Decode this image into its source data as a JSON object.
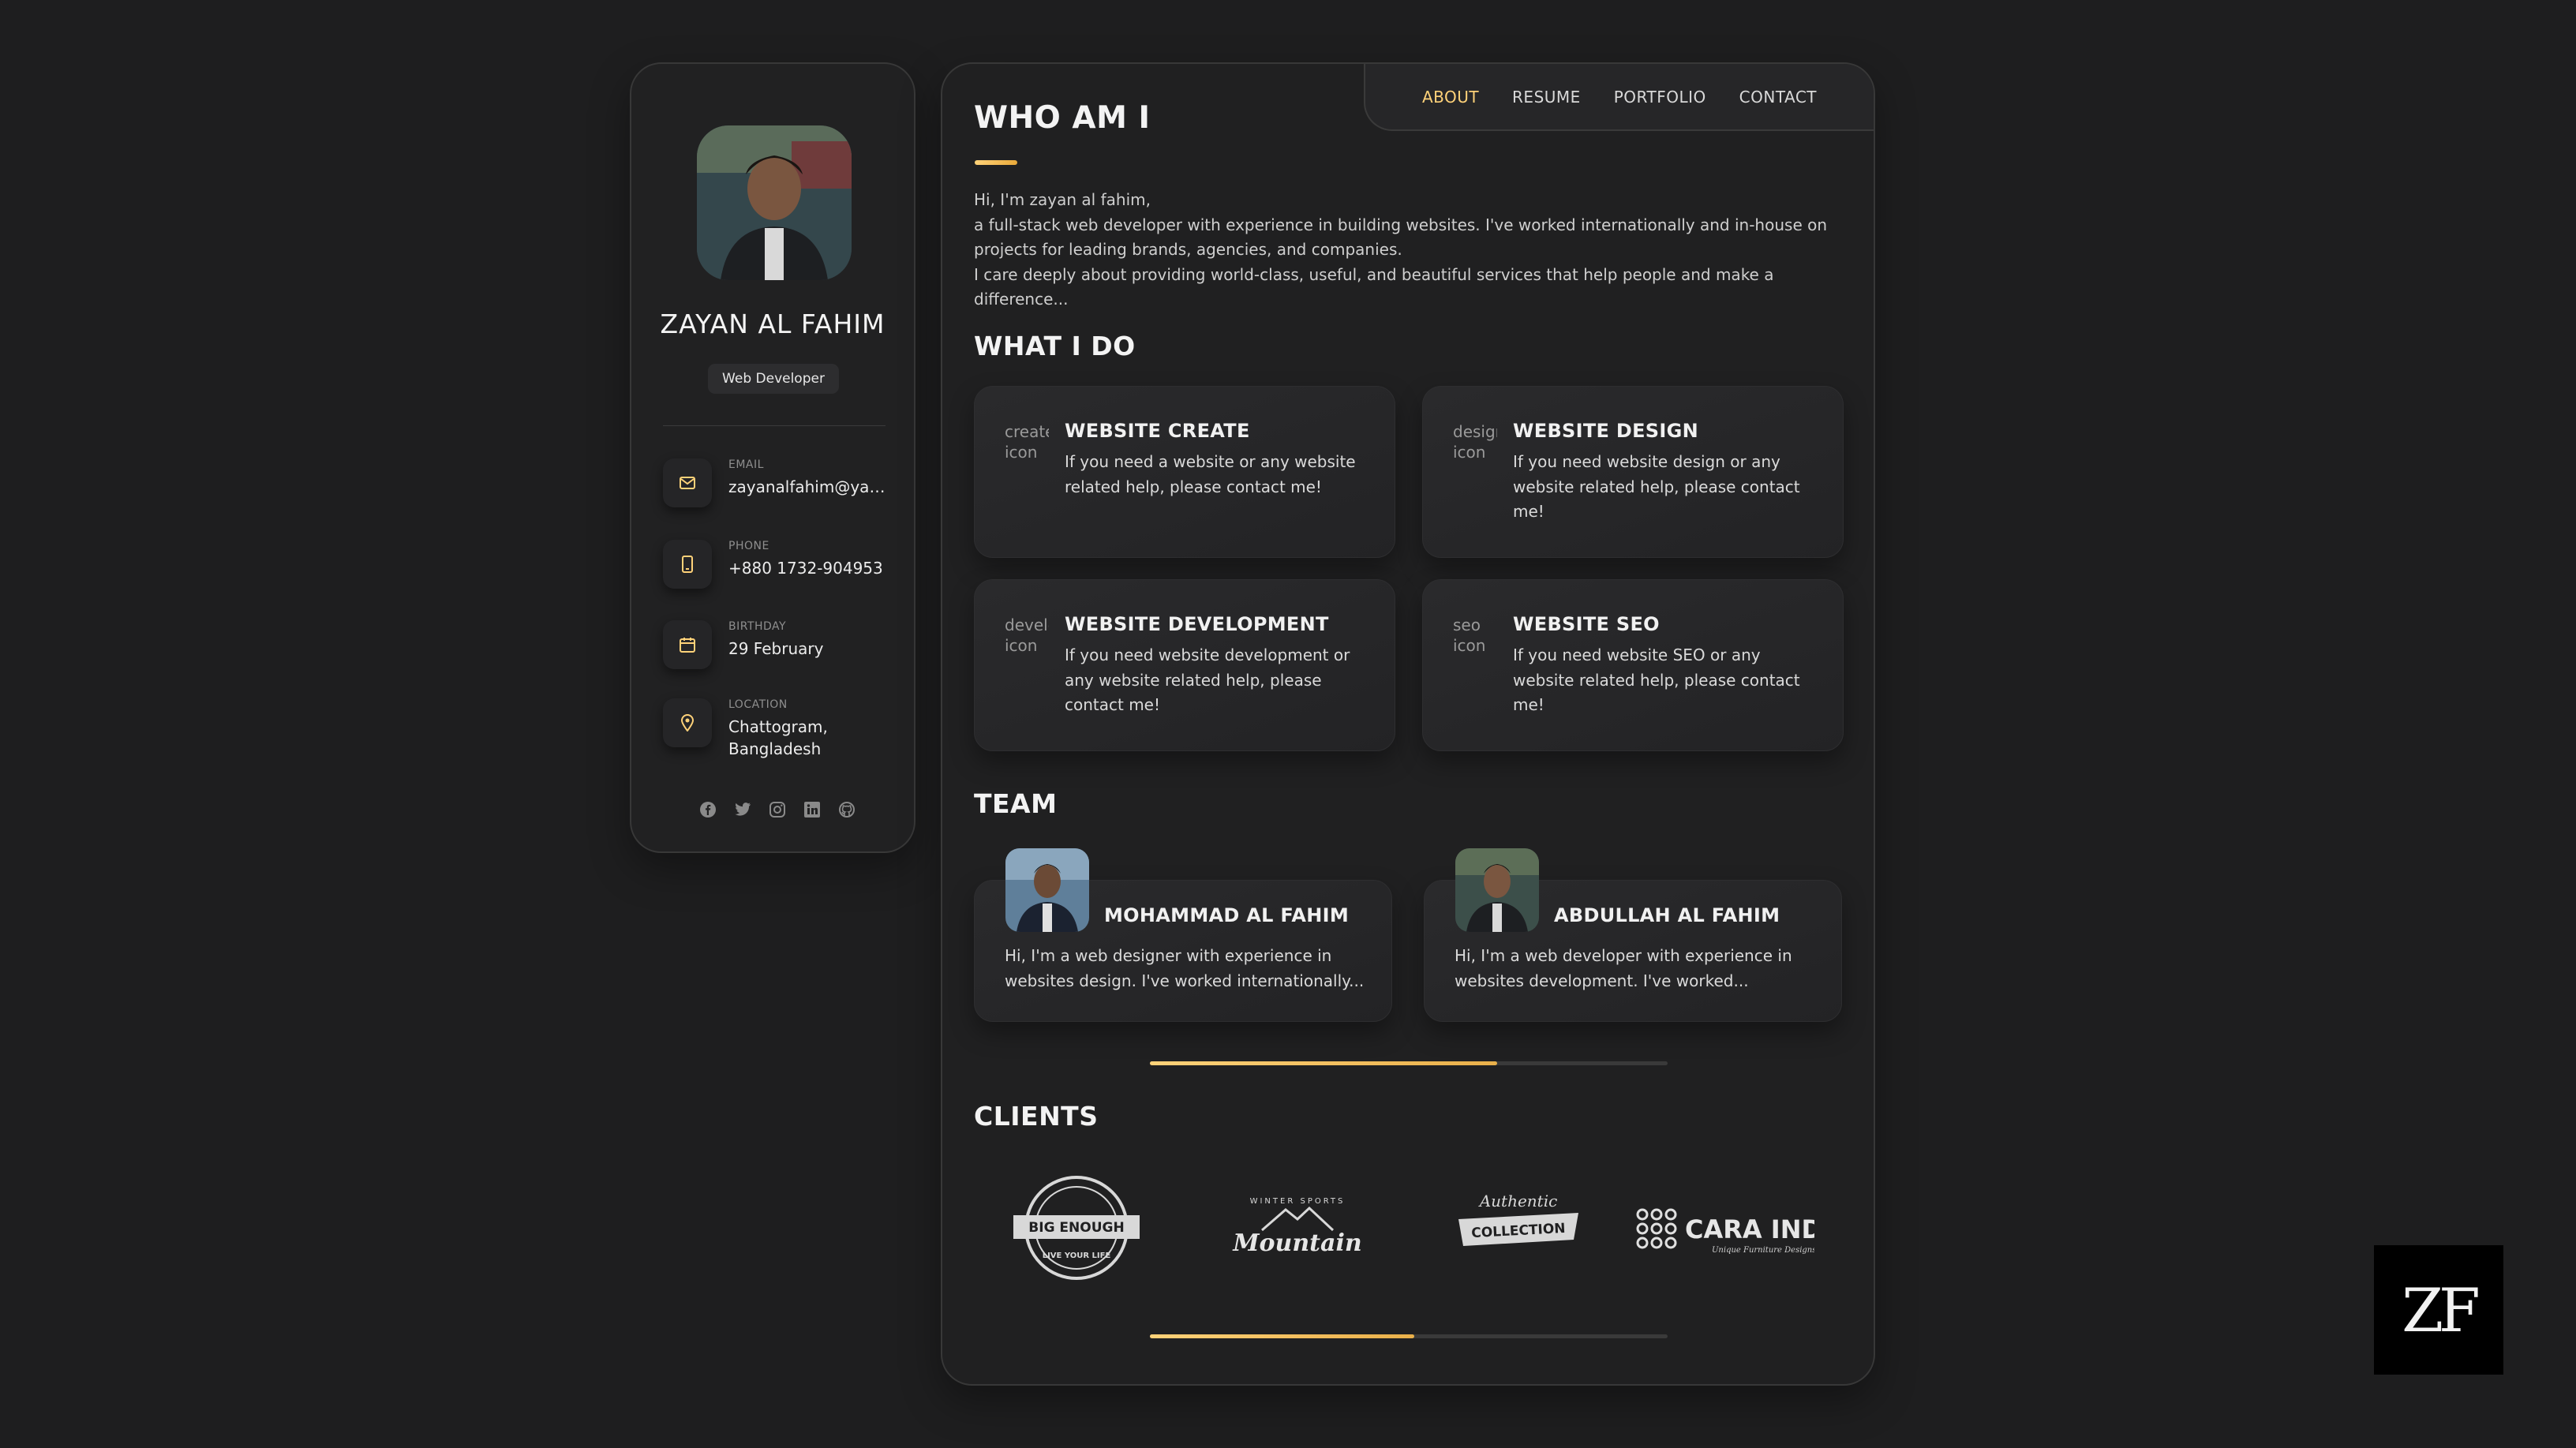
{
  "profile": {
    "name": "ZAYAN AL FAHIM",
    "role": "Web Developer",
    "contacts": [
      {
        "icon": "mail-icon",
        "label": "EMAIL",
        "value": "zayanalfahim@yahoo.com"
      },
      {
        "icon": "phone-icon",
        "label": "PHONE",
        "value": "+880 1732-904953"
      },
      {
        "icon": "calendar-icon",
        "label": "BIRTHDAY",
        "value": "29 February"
      },
      {
        "icon": "location-icon",
        "label": "LOCATION",
        "value": "Chattogram, Bangladesh"
      }
    ],
    "socials": [
      "facebook-icon",
      "twitter-icon",
      "instagram-icon",
      "linkedin-icon",
      "github-icon"
    ]
  },
  "nav": {
    "items": [
      "ABOUT",
      "RESUME",
      "PORTFOLIO",
      "CONTACT"
    ],
    "active": "ABOUT"
  },
  "about": {
    "title": "WHO AM I",
    "lines": [
      "Hi, I'm zayan al fahim,",
      "a full-stack web developer with experience in building websites. I've worked internationally and in-house on projects for leading brands, agencies, and companies.",
      "I care deeply about providing world-class, useful, and beautiful services that help people and make a difference..."
    ]
  },
  "services": {
    "title": "WHAT I DO",
    "items": [
      {
        "alt": "create icon",
        "title": "WEBSITE CREATE",
        "text": "If you need a website or any website related help, please contact me!"
      },
      {
        "alt": "design icon",
        "title": "WEBSITE DESIGN",
        "text": "If you need website design or any website related help, please contact me!"
      },
      {
        "alt": "development icon",
        "title": "WEBSITE DEVELOPMENT",
        "text": "If you need website development or any website related help, please contact me!"
      },
      {
        "alt": "seo icon",
        "title": "WEBSITE SEO",
        "text": "If you need website SEO or any website related help, please contact me!"
      }
    ]
  },
  "team": {
    "title": "TEAM",
    "members": [
      {
        "name": "MOHAMMAD AL FAHIM",
        "text": "Hi, I'm a web designer with experience in websites design. I've worked internationally..."
      },
      {
        "name": "ABDULLAH AL FAHIM",
        "text": "Hi, I'm a web developer with experience in websites development. I've worked..."
      }
    ],
    "slider_progress": 0.67
  },
  "clients": {
    "title": "CLIENTS",
    "logos": [
      {
        "text": "BIG ENOUGH",
        "sub": "LIVE YOUR LIFE"
      },
      {
        "text": "Mountain",
        "sub": "WINTER SPORTS"
      },
      {
        "text": "COLLECTION",
        "sub": "Authentic"
      },
      {
        "text": "CARA INDOORS",
        "sub": "Unique Furniture Designs"
      }
    ],
    "slider_progress": 0.51
  },
  "brand_mark": "ZF",
  "colors": {
    "accent": "#ffd279",
    "background": "#1e1e1f",
    "panel": "#202021"
  }
}
